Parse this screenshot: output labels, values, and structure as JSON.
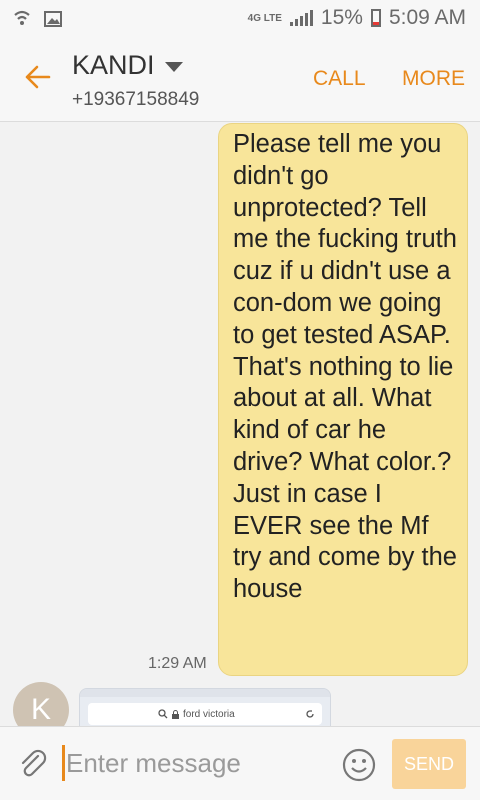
{
  "status_bar": {
    "network": "4G LTE",
    "battery": "15%",
    "time": "5:09 AM"
  },
  "header": {
    "contact_name": "KANDI",
    "phone_number": "+19367158849",
    "call_label": "CALL",
    "more_label": "MORE"
  },
  "messages": [
    {
      "direction": "outgoing",
      "text": "Please tell me you didn't go unprotected? Tell me the fucking truth cuz if u didn't use a con-dom we going to get tested ASAP. That's nothing to lie about at all. What kind of car he drive? What color.? Just in case I EVER see the Mf try and come by the house",
      "time": "1:29 AM"
    }
  ],
  "incoming": {
    "avatar_letter": "K",
    "attachment_search_text": "ford victoria"
  },
  "composer": {
    "placeholder": "Enter message",
    "send_label": "SEND"
  },
  "colors": {
    "accent": "#e8891c",
    "outgoing_bubble": "#f8e59a",
    "send_disabled": "#f9d49a"
  },
  "icons": [
    "wifi-call-icon",
    "image-icon",
    "signal-icon",
    "battery-icon",
    "back-arrow-icon",
    "dropdown-caret-icon",
    "attach-icon",
    "emoji-icon",
    "search-icon",
    "lock-icon",
    "refresh-icon"
  ]
}
